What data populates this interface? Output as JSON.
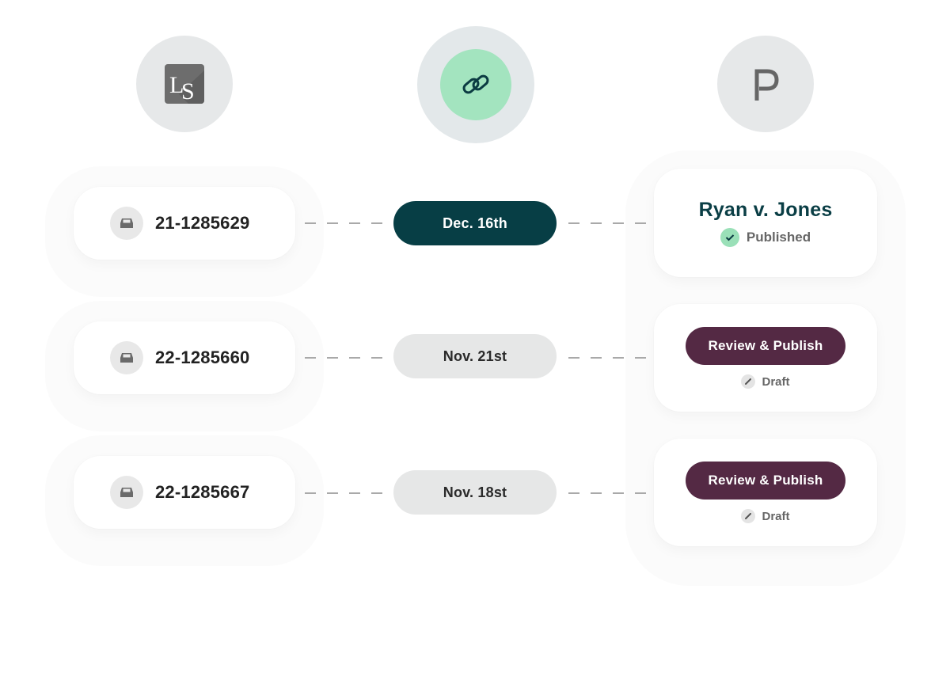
{
  "integrations": {
    "left": {
      "icon": "ls-logo-icon",
      "logo_text": "LS"
    },
    "center": {
      "icon": "link-icon"
    },
    "right": {
      "icon": "p-logo-icon",
      "logo_text": "P"
    }
  },
  "colors": {
    "active_date": "#073e45",
    "review_button": "#542944",
    "published_check": "#9ae0b8",
    "link_accent": "#a3e4bf"
  },
  "rows": [
    {
      "case_number": "21-1285629",
      "date": "Dec. 16th",
      "date_active": true,
      "case_title": "Ryan v. Jones",
      "status": "Published",
      "status_icon": "check-icon"
    },
    {
      "case_number": "22-1285660",
      "date": "Nov. 21st",
      "date_active": false,
      "action_label": "Review & Publish",
      "status": "Draft",
      "status_icon": "pencil-icon"
    },
    {
      "case_number": "22-1285667",
      "date": "Nov. 18st",
      "date_active": false,
      "action_label": "Review & Publish",
      "status": "Draft",
      "status_icon": "pencil-icon"
    }
  ]
}
